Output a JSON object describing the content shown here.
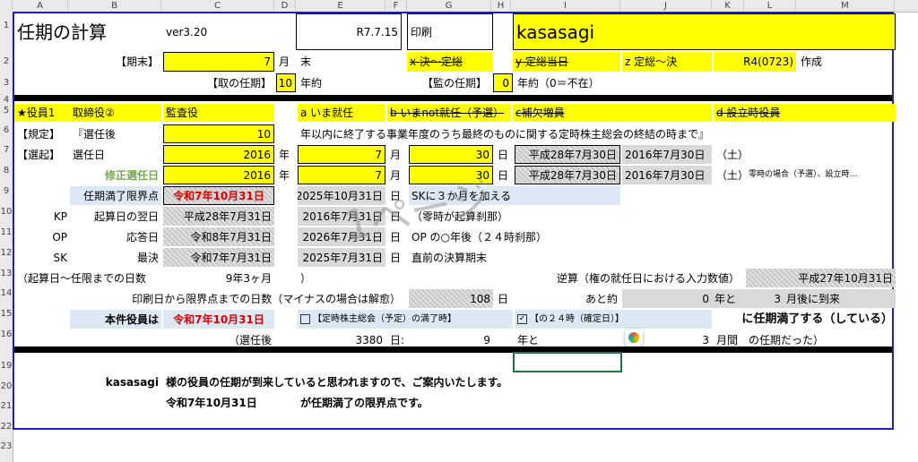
{
  "columns": [
    "A",
    "B",
    "C",
    "D",
    "E",
    "F",
    "G",
    "H",
    "I",
    "J",
    "K",
    "L",
    "M"
  ],
  "rows": [
    "1",
    "2",
    "3",
    "4",
    "5",
    "6",
    "7",
    "8",
    "9",
    "10",
    "11",
    "12",
    "13",
    "14",
    "15",
    "16",
    "19",
    "20",
    "21",
    "22",
    "23"
  ],
  "header": {
    "title": "任期の計算",
    "version": "ver3.20",
    "date": "R7.7.15",
    "print_label": "印刷",
    "company": "kasasagi"
  },
  "row2": {
    "period_label": "【期末】",
    "month_value": "7",
    "month_unit": "月",
    "end_text": "末",
    "x_text": "x 決～定総",
    "y_text": "y 定総当日",
    "z_text": "z 定総～決",
    "created_code": "R4(0723)",
    "created_label": "作成"
  },
  "row3": {
    "director_term_label": "【取の任期】",
    "director_term_value": "10",
    "year_unit": "年約",
    "auditor_term_label": "【監の任期】",
    "auditor_term_value": "0",
    "auditor_term_note": "年約（0＝不在）"
  },
  "row5": {
    "officer_label": "★役員1",
    "director_role": "取締役②",
    "auditor_role": "監査役",
    "a_option": "a いま就任",
    "b_option": "b いまnot就任（予選）",
    "c_option": "c補欠増員",
    "d_option": "d 設立時役員"
  },
  "row6": {
    "rule_label": "【規定】",
    "after_election": "『選任後",
    "years_value": "10",
    "rule_text": "年以内に終了する事業年度のうち最終のものに関する定時株主総会の終結の時まで』"
  },
  "row7": {
    "elect_label": "【選起】",
    "elect_date_label": "選任日",
    "year_value": "2016",
    "year_unit": "年",
    "month_value": "7",
    "month_unit": "月",
    "day_value": "30",
    "day_unit": "日",
    "wareki": "平成28年7月30日",
    "seireki": "2016年7月30日",
    "weekday": "（土）"
  },
  "row8": {
    "corrected_label": "修正選任日",
    "year_value": "2016",
    "year_unit": "年",
    "month_value": "7",
    "month_unit": "月",
    "day_value": "30",
    "day_unit": "日",
    "wareki": "平成28年7月30日",
    "seireki": "2016年7月30日",
    "weekday": "（土）",
    "note": "零時の場合（予選）、設立時…"
  },
  "row9": {
    "limit_label": "任期満了限界点",
    "limit_wareki": "令和7年10月31日",
    "limit_seireki": "2025年10月31日",
    "limit_unit": "日",
    "sk_note": "SKに３か月を加える"
  },
  "row10": {
    "code": "KP",
    "label": "起算日の翌日",
    "wareki": "平成28年7月31日",
    "seireki": "2016年7月31日",
    "unit": "日",
    "note": "（零時が起算刹那）"
  },
  "row11": {
    "code": "OP",
    "label": "応答日",
    "wareki": "令和8年7月31日",
    "seireki": "2026年7月31日",
    "unit": "日",
    "note": "OP の○年後（２４時刹那）"
  },
  "row12": {
    "code": "SK",
    "label": "最決",
    "wareki": "令和7年7月31日",
    "seireki": "2025年7月31日",
    "unit": "日",
    "note": "直前の決算期末"
  },
  "row13": {
    "label": "（起算日～任限までの日数",
    "value": "9年3ヶ月",
    "close": "）",
    "reverse_label": "逆算（権の就任日における入力数値）",
    "reverse_value": "平成27年10月31日"
  },
  "row14": {
    "label": "印刷日から限界点までの日数（マイナスの場合は解愈）",
    "days": "108",
    "day_unit": "日",
    "remaining_label": "あと約",
    "years": "0",
    "years_unit": "年と",
    "months": "3",
    "months_unit": "月後に到来"
  },
  "row15": {
    "label": "本件役員は",
    "date": "令和7年10月31日",
    "check1": "【定時株主総会（予定）の満了時】",
    "check2": "【の２４時（確定日）】",
    "result": "に任期満了する（している）"
  },
  "row16": {
    "after": "（選任後",
    "days": "3380",
    "days_unit": "日:",
    "years": "9",
    "years_unit": "年と",
    "months": "3",
    "months_unit": "月間",
    "term_text": "の任期だった）"
  },
  "row21": {
    "company": "kasasagi",
    "message": "様の役員の任期が到来していると思われますので、ご案内いたします。"
  },
  "row22": {
    "date": "令和7年10月31日",
    "message": "が任期満了の限界点です。"
  },
  "watermark": "1ページ"
}
